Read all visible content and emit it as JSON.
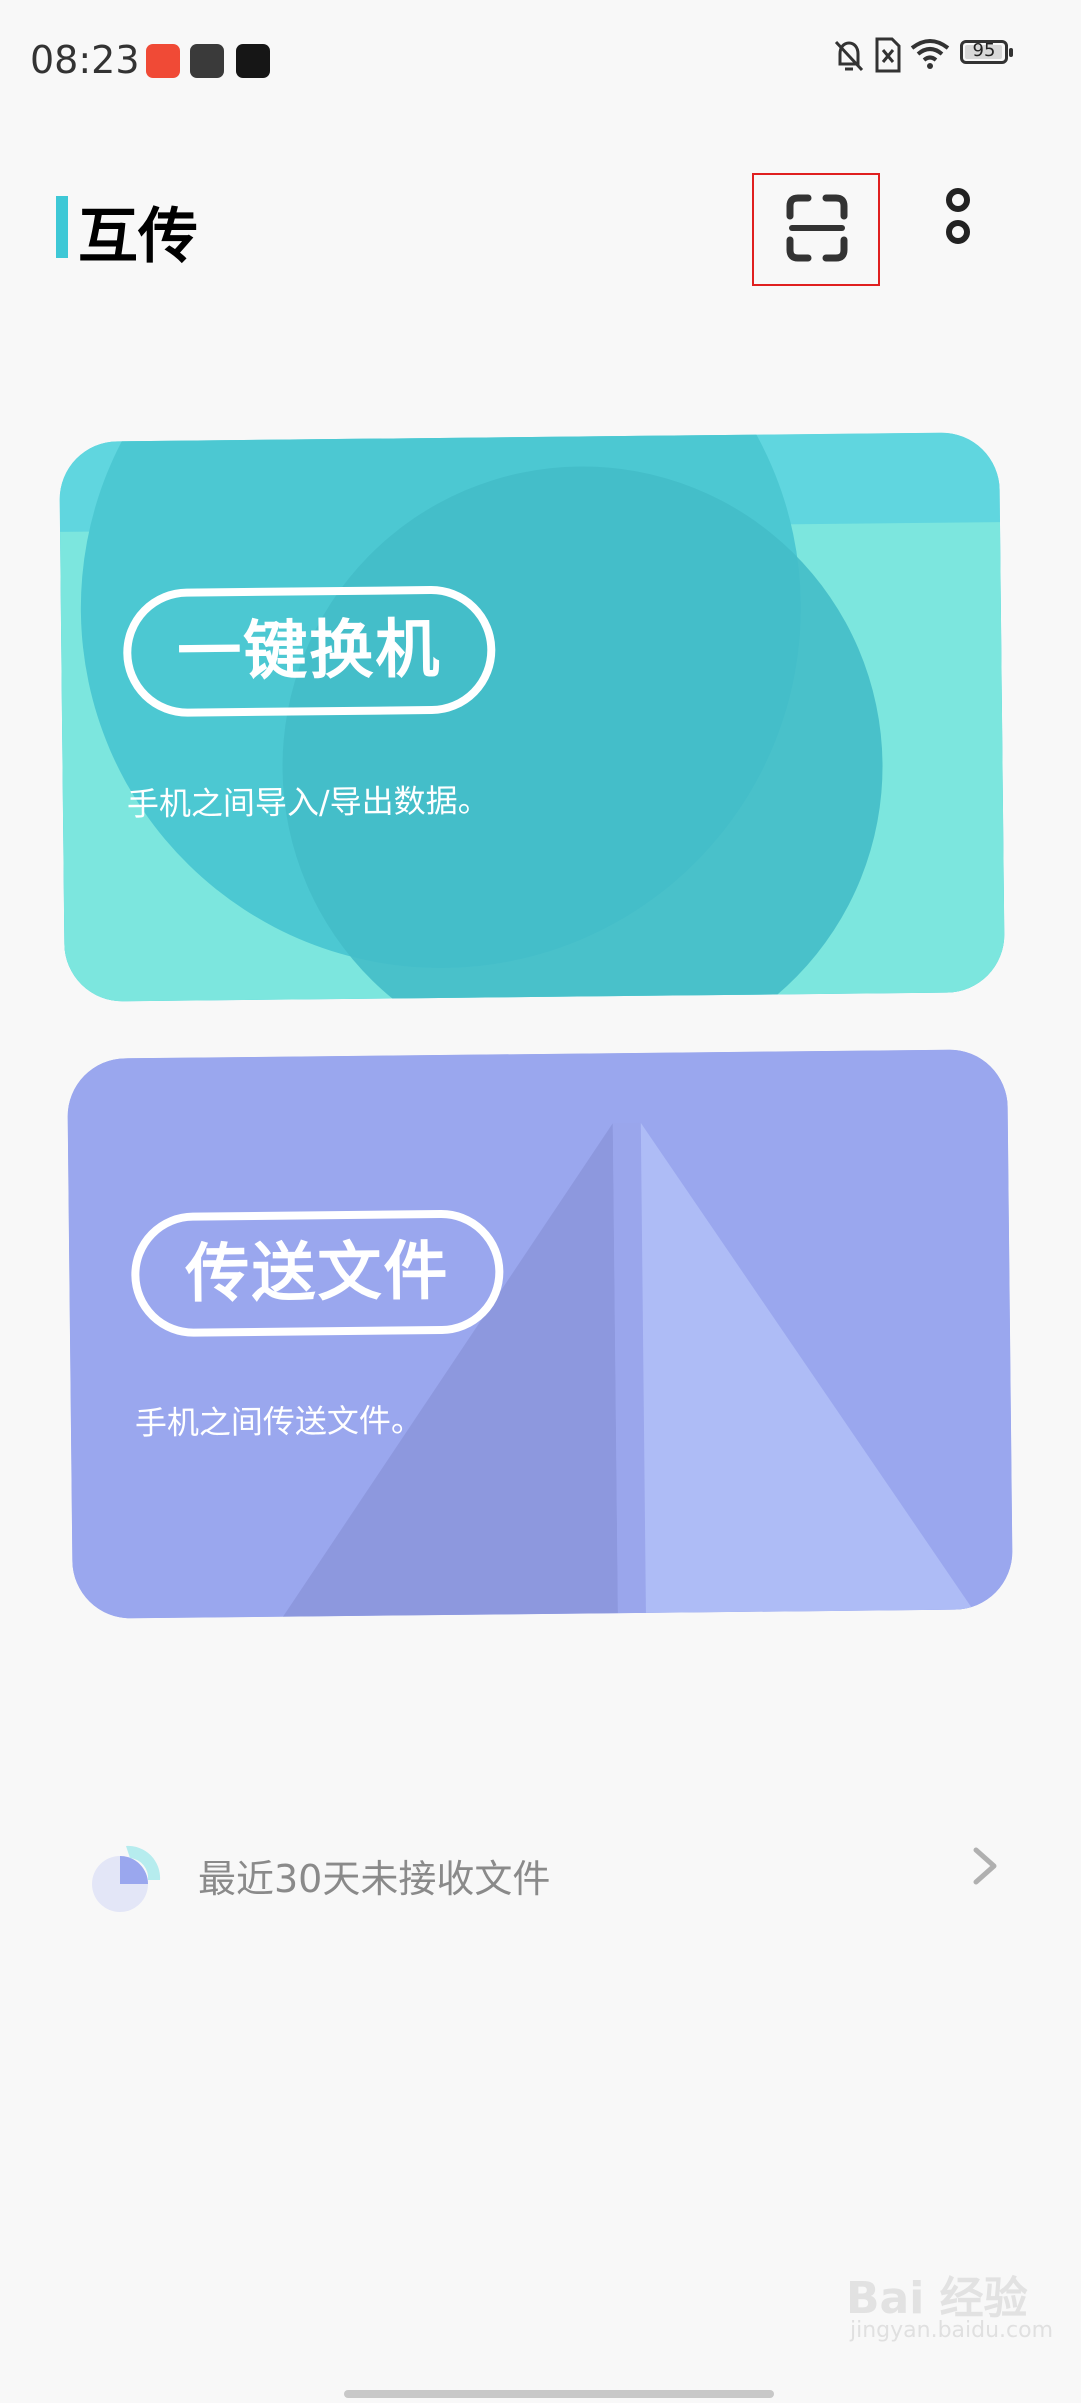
{
  "status_bar": {
    "time": "08:23",
    "battery": "95",
    "notification_icons": [
      "weibo-icon",
      "bag-icon",
      "tiktok-icon"
    ],
    "right_icons": [
      "bell-off-icon",
      "no-sim-icon",
      "wifi-icon",
      "battery-icon"
    ]
  },
  "header": {
    "title": "互传",
    "accent_color": "#3ec8d6",
    "actions": [
      "scan-icon",
      "more-icon"
    ]
  },
  "cards": [
    {
      "label": "一键换机",
      "description": "手机之间导入/导出数据。",
      "color": "#62d8e0"
    },
    {
      "label": "传送文件",
      "description": "手机之间传送文件。",
      "color": "#9aa7ee"
    }
  ],
  "recent": {
    "text": "最近30天未接收文件"
  },
  "watermark": {
    "brand": "Bai 经验",
    "url": "jingyan.baidu.com"
  }
}
